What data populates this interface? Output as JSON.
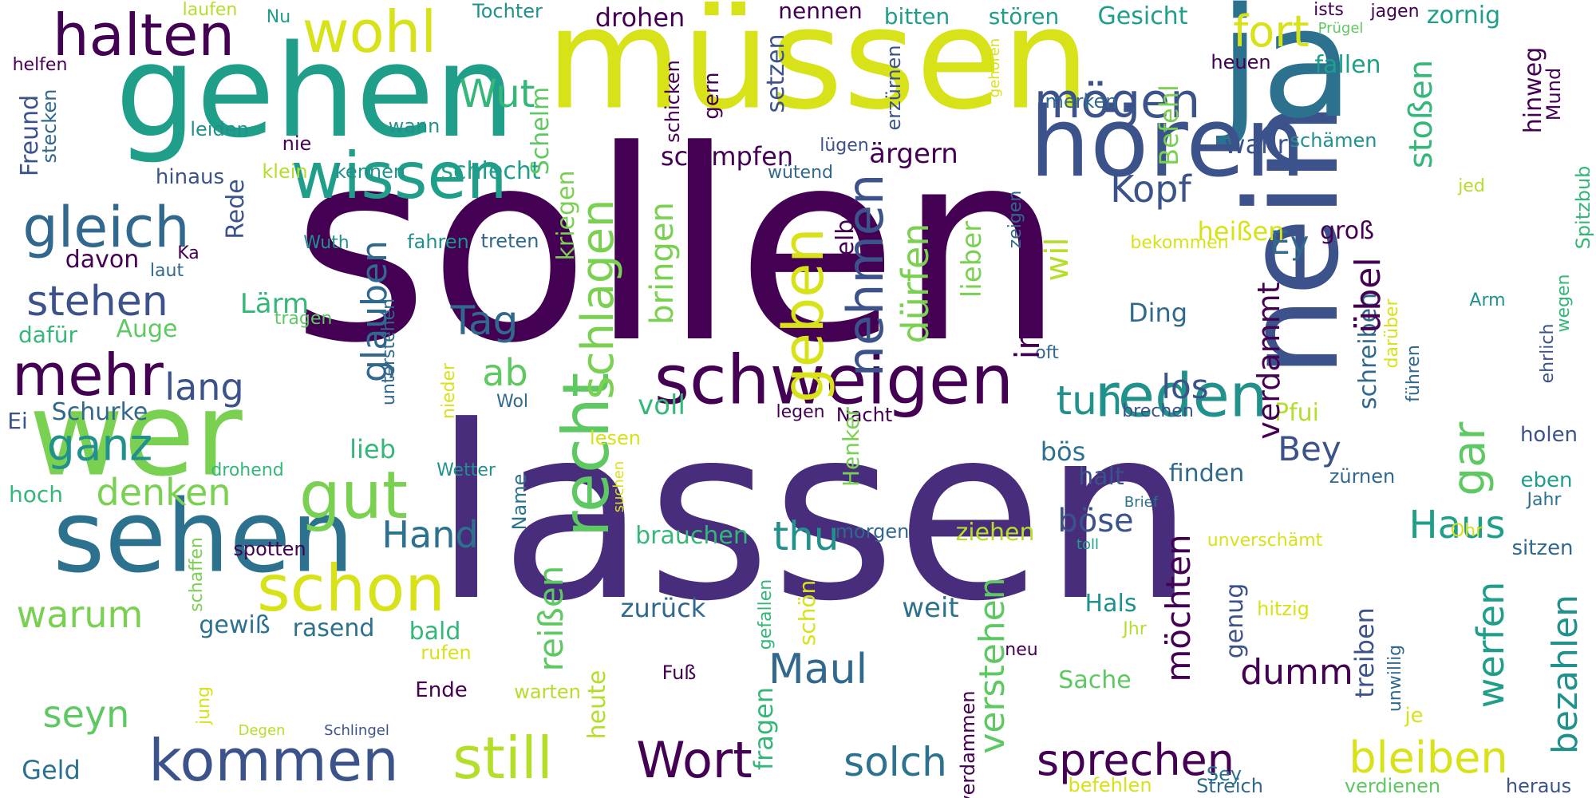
{
  "words": [
    {
      "text": "sollen",
      "color": "#440154"
    },
    {
      "text": "lassen",
      "color": "#472d7b"
    },
    {
      "text": "müssen",
      "color": "#d8e219"
    },
    {
      "text": "gehen",
      "color": "#1f9e89"
    },
    {
      "text": "nein",
      "color": "#3b528b"
    },
    {
      "text": "ja",
      "color": "#2c728e"
    },
    {
      "text": "hören",
      "color": "#3b528b"
    },
    {
      "text": "wer",
      "color": "#7ad151"
    },
    {
      "text": "sehen",
      "color": "#2c728e"
    },
    {
      "text": "schweigen",
      "color": "#440154"
    },
    {
      "text": "reden",
      "color": "#21918c"
    },
    {
      "text": "kommen",
      "color": "#3b528b"
    },
    {
      "text": "wissen",
      "color": "#1f9e89"
    },
    {
      "text": "schon",
      "color": "#d8e219"
    },
    {
      "text": "gut",
      "color": "#7ad151"
    },
    {
      "text": "halten",
      "color": "#440154"
    },
    {
      "text": "wohl",
      "color": "#d8e219"
    },
    {
      "text": "mögen",
      "color": "#3b528b"
    },
    {
      "text": "gleich",
      "color": "#31688e"
    },
    {
      "text": "mehr",
      "color": "#440154"
    },
    {
      "text": "ganz",
      "color": "#21918c"
    },
    {
      "text": "still",
      "color": "#b5de2b"
    },
    {
      "text": "Wort",
      "color": "#440154"
    },
    {
      "text": "solch",
      "color": "#2c728e"
    },
    {
      "text": "sprechen",
      "color": "#440154"
    },
    {
      "text": "bleiben",
      "color": "#d8e219"
    },
    {
      "text": "geben",
      "color": "#d8e219"
    },
    {
      "text": "recht",
      "color": "#5ec962"
    },
    {
      "text": "nehmen",
      "color": "#3b528b"
    },
    {
      "text": "schlagen",
      "color": "#7ad151"
    },
    {
      "text": "Wut",
      "color": "#35b779"
    },
    {
      "text": "fort",
      "color": "#d8e219"
    },
    {
      "text": "Kopf",
      "color": "#3b528b"
    },
    {
      "text": "stehen",
      "color": "#3b528b"
    },
    {
      "text": "lang",
      "color": "#3b528b"
    },
    {
      "text": "denken",
      "color": "#7ad151"
    },
    {
      "text": "warum",
      "color": "#7ad151"
    },
    {
      "text": "seyn",
      "color": "#5ec962"
    },
    {
      "text": "Geld",
      "color": "#2c728e"
    },
    {
      "text": "Hand",
      "color": "#2c728e"
    },
    {
      "text": "Maul",
      "color": "#31688e"
    },
    {
      "text": "tun",
      "color": "#21918c"
    },
    {
      "text": "thu",
      "color": "#21918c"
    },
    {
      "text": "Tag",
      "color": "#31688e"
    },
    {
      "text": "ab",
      "color": "#5ec962"
    },
    {
      "text": "Bey",
      "color": "#3b528b"
    },
    {
      "text": "Haus",
      "color": "#1f9e89"
    },
    {
      "text": "gar",
      "color": "#5ec962"
    },
    {
      "text": "dumm",
      "color": "#440154"
    },
    {
      "text": "böse",
      "color": "#3b528b"
    },
    {
      "text": "los",
      "color": "#3b528b"
    },
    {
      "text": "Ey",
      "color": "#31688e"
    },
    {
      "text": "schimpfen",
      "color": "#440154"
    },
    {
      "text": "drohen",
      "color": "#440154"
    },
    {
      "text": "nennen",
      "color": "#440154"
    },
    {
      "text": "bitten",
      "color": "#1f9e89"
    },
    {
      "text": "stören",
      "color": "#1f9e89"
    },
    {
      "text": "Gesicht",
      "color": "#1f9e89"
    },
    {
      "text": "zornig",
      "color": "#1f9e89"
    },
    {
      "text": "Tochter",
      "color": "#21918c"
    },
    {
      "text": "laufen",
      "color": "#b5de2b"
    },
    {
      "text": "Nu",
      "color": "#1f9e89"
    },
    {
      "text": "helfen",
      "color": "#440154"
    },
    {
      "text": "ists",
      "color": "#440154"
    },
    {
      "text": "jagen",
      "color": "#440154"
    },
    {
      "text": "Prügel",
      "color": "#5ec962"
    },
    {
      "text": "heuen",
      "color": "#440154"
    },
    {
      "text": "fallen",
      "color": "#1f9e89"
    },
    {
      "text": "merken",
      "color": "#31688e"
    },
    {
      "text": "wahr",
      "color": "#3b528b"
    },
    {
      "text": "schämen",
      "color": "#21918c"
    },
    {
      "text": "leiden",
      "color": "#21918c"
    },
    {
      "text": "wann",
      "color": "#21918c"
    },
    {
      "text": "nie",
      "color": "#440154"
    },
    {
      "text": "hinaus",
      "color": "#3b528b"
    },
    {
      "text": "klein",
      "color": "#b5de2b"
    },
    {
      "text": "kennen",
      "color": "#21918c"
    },
    {
      "text": "schlecht",
      "color": "#1f9e89"
    },
    {
      "text": "ärgern",
      "color": "#440154"
    },
    {
      "text": "wütend",
      "color": "#31688e"
    },
    {
      "text": "lügen",
      "color": "#3b528b"
    },
    {
      "text": "heißen",
      "color": "#d8e219"
    },
    {
      "text": "groß",
      "color": "#440154"
    },
    {
      "text": "jed",
      "color": "#b5de2b"
    },
    {
      "text": "davon",
      "color": "#440154"
    },
    {
      "text": "Ka",
      "color": "#440154"
    },
    {
      "text": "laut",
      "color": "#31688e"
    },
    {
      "text": "Wuth",
      "color": "#21918c"
    },
    {
      "text": "fahren",
      "color": "#21918c"
    },
    {
      "text": "treten",
      "color": "#31688e"
    },
    {
      "text": "bekommen",
      "color": "#d8e219"
    },
    {
      "text": "Lärm",
      "color": "#35b779"
    },
    {
      "text": "tragen",
      "color": "#5ec962"
    },
    {
      "text": "dafür",
      "color": "#35b779"
    },
    {
      "text": "Auge",
      "color": "#5ec962"
    },
    {
      "text": "Ding",
      "color": "#31688e"
    },
    {
      "text": "Arm",
      "color": "#21918c"
    },
    {
      "text": "oft",
      "color": "#31688e"
    },
    {
      "text": "Schurke",
      "color": "#31688e"
    },
    {
      "text": "Wol",
      "color": "#31688e"
    },
    {
      "text": "legen",
      "color": "#440154"
    },
    {
      "text": "Nacht",
      "color": "#440154"
    },
    {
      "text": "brechen",
      "color": "#3b528b"
    },
    {
      "text": "Pfui",
      "color": "#b5de2b"
    },
    {
      "text": "voll",
      "color": "#35b779"
    },
    {
      "text": "Ei",
      "color": "#3b528b"
    },
    {
      "text": "lieb",
      "color": "#35b779"
    },
    {
      "text": "holen",
      "color": "#3b528b"
    },
    {
      "text": "lesen",
      "color": "#d8e219"
    },
    {
      "text": "bös",
      "color": "#2c728e"
    },
    {
      "text": "halt",
      "color": "#3b528b"
    },
    {
      "text": "finden",
      "color": "#31688e"
    },
    {
      "text": "zürnen",
      "color": "#31688e"
    },
    {
      "text": "drohend",
      "color": "#35b779"
    },
    {
      "text": "Wetter",
      "color": "#21918c"
    },
    {
      "text": "hoch",
      "color": "#35b779"
    },
    {
      "text": "eben",
      "color": "#1f9e89"
    },
    {
      "text": "Jahr",
      "color": "#2c728e"
    },
    {
      "text": "Brief",
      "color": "#2c728e"
    },
    {
      "text": "brauchen",
      "color": "#35b779"
    },
    {
      "text": "morgen",
      "color": "#31688e"
    },
    {
      "text": "ziehen",
      "color": "#b5de2b"
    },
    {
      "text": "unverschämt",
      "color": "#d8e219"
    },
    {
      "text": "Ohr",
      "color": "#d8e219"
    },
    {
      "text": "toll",
      "color": "#1f9e89"
    },
    {
      "text": "sitzen",
      "color": "#31688e"
    },
    {
      "text": "spotten",
      "color": "#440154"
    },
    {
      "text": "zurück",
      "color": "#31688e"
    },
    {
      "text": "weit",
      "color": "#2c728e"
    },
    {
      "text": "Hals",
      "color": "#21918c"
    },
    {
      "text": "gewiß",
      "color": "#2c728e"
    },
    {
      "text": "rasend",
      "color": "#2c728e"
    },
    {
      "text": "bald",
      "color": "#35b779"
    },
    {
      "text": "hitzig",
      "color": "#d8e219"
    },
    {
      "text": "rufen",
      "color": "#d8e219"
    },
    {
      "text": "Jhr",
      "color": "#b5de2b"
    },
    {
      "text": "neu",
      "color": "#440154"
    },
    {
      "text": "Sache",
      "color": "#5ec962"
    },
    {
      "text": "Fuß",
      "color": "#440154"
    },
    {
      "text": "Ende",
      "color": "#440154"
    },
    {
      "text": "warten",
      "color": "#b5de2b"
    },
    {
      "text": "Degen",
      "color": "#b5de2b"
    },
    {
      "text": "Schlingel",
      "color": "#3b528b"
    },
    {
      "text": "je",
      "color": "#d8e219"
    },
    {
      "text": "Sey",
      "color": "#2c728e"
    },
    {
      "text": "befehlen",
      "color": "#d8e219"
    },
    {
      "text": "Streich",
      "color": "#31688e"
    },
    {
      "text": "verdienen",
      "color": "#5ec962"
    },
    {
      "text": "heraus",
      "color": "#3b528b"
    },
    {
      "text": "Freund",
      "color": "#3b528b"
    },
    {
      "text": "stecken",
      "color": "#31688e"
    },
    {
      "text": "Rede",
      "color": "#3b528b"
    },
    {
      "text": "Schelm",
      "color": "#5ec962"
    },
    {
      "text": "setzen",
      "color": "#3b528b"
    },
    {
      "text": "schicken",
      "color": "#440154"
    },
    {
      "text": "gern",
      "color": "#440154"
    },
    {
      "text": "erzürnen",
      "color": "#3b528b"
    },
    {
      "text": "gehören",
      "color": "#d8e219"
    },
    {
      "text": "Befehl",
      "color": "#7ad151"
    },
    {
      "text": "stoßen",
      "color": "#35b779"
    },
    {
      "text": "hinweg",
      "color": "#440154"
    },
    {
      "text": "Mund",
      "color": "#440154"
    },
    {
      "text": "Spitzbub",
      "color": "#35b779"
    },
    {
      "text": "wegen",
      "color": "#35b779"
    },
    {
      "text": "ehrlich",
      "color": "#3b528b"
    },
    {
      "text": "führen",
      "color": "#31688e"
    },
    {
      "text": "darüber",
      "color": "#d8e219"
    },
    {
      "text": "schreiben",
      "color": "#31688e"
    },
    {
      "text": "übel",
      "color": "#440154"
    },
    {
      "text": "verdammt",
      "color": "#440154"
    },
    {
      "text": "immer",
      "color": "#440154"
    },
    {
      "text": "wil",
      "color": "#b5de2b"
    },
    {
      "text": "lieber",
      "color": "#7ad151"
    },
    {
      "text": "zeigen",
      "color": "#31688e"
    },
    {
      "text": "selber",
      "color": "#440154"
    },
    {
      "text": "dürfen",
      "color": "#7ad151"
    },
    {
      "text": "bringen",
      "color": "#7ad151"
    },
    {
      "text": "kriegen",
      "color": "#7ad151"
    },
    {
      "text": "glauben",
      "color": "#31688e"
    },
    {
      "text": "unterstehen",
      "color": "#31688e"
    },
    {
      "text": "nieder",
      "color": "#d8e219"
    },
    {
      "text": "Henker",
      "color": "#7ad151"
    },
    {
      "text": "Name",
      "color": "#2c728e"
    },
    {
      "text": "suchen",
      "color": "#d8e219"
    },
    {
      "text": "schaffen",
      "color": "#7ad151"
    },
    {
      "text": "jung",
      "color": "#d8e219"
    },
    {
      "text": "heute",
      "color": "#b5de2b"
    },
    {
      "text": "reißen",
      "color": "#5ec962"
    },
    {
      "text": "gefallen",
      "color": "#35b779"
    },
    {
      "text": "schön",
      "color": "#d8e219"
    },
    {
      "text": "fragen",
      "color": "#35b779"
    },
    {
      "text": "verstehen",
      "color": "#5ec962"
    },
    {
      "text": "verdammen",
      "color": "#440154"
    },
    {
      "text": "möchten",
      "color": "#440154"
    },
    {
      "text": "genug",
      "color": "#3b528b"
    },
    {
      "text": "treiben",
      "color": "#3b528b"
    },
    {
      "text": "unwillig",
      "color": "#31688e"
    },
    {
      "text": "werfen",
      "color": "#1f9e89"
    },
    {
      "text": "bezahlen",
      "color": "#21918c"
    }
  ]
}
